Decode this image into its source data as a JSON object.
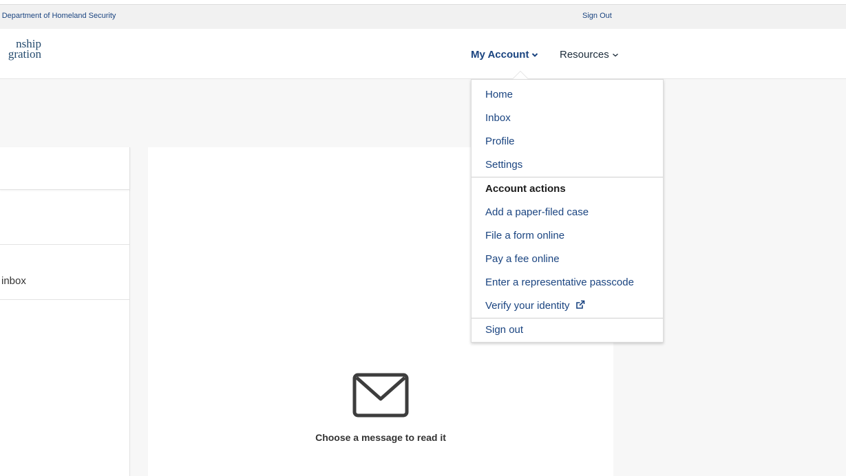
{
  "topbar": {
    "agency_link": "Department of Homeland Security",
    "sign_out": "Sign Out"
  },
  "logo": {
    "line1": "nship",
    "line2": "gration"
  },
  "nav": {
    "my_account": "My Account",
    "resources": "Resources"
  },
  "dropdown": {
    "items": [
      {
        "label": "Home"
      },
      {
        "label": "Inbox"
      },
      {
        "label": "Profile"
      },
      {
        "label": "Settings"
      }
    ],
    "account_actions_heading": "Account actions",
    "actions": [
      {
        "label": "Add a paper-filed case"
      },
      {
        "label": "File a form online"
      },
      {
        "label": "Pay a fee online"
      },
      {
        "label": "Enter a representative passcode"
      },
      {
        "label": "Verify your identity",
        "icon": "external-link-icon"
      }
    ],
    "sign_out": "Sign out"
  },
  "left_panel": {
    "inbox_text": "inbox"
  },
  "main": {
    "empty_icon": "envelope-icon",
    "empty_message": "Choose a message to read it"
  },
  "colors": {
    "link": "#1a4480",
    "text": "#333333",
    "background": "#f7f7f7"
  }
}
